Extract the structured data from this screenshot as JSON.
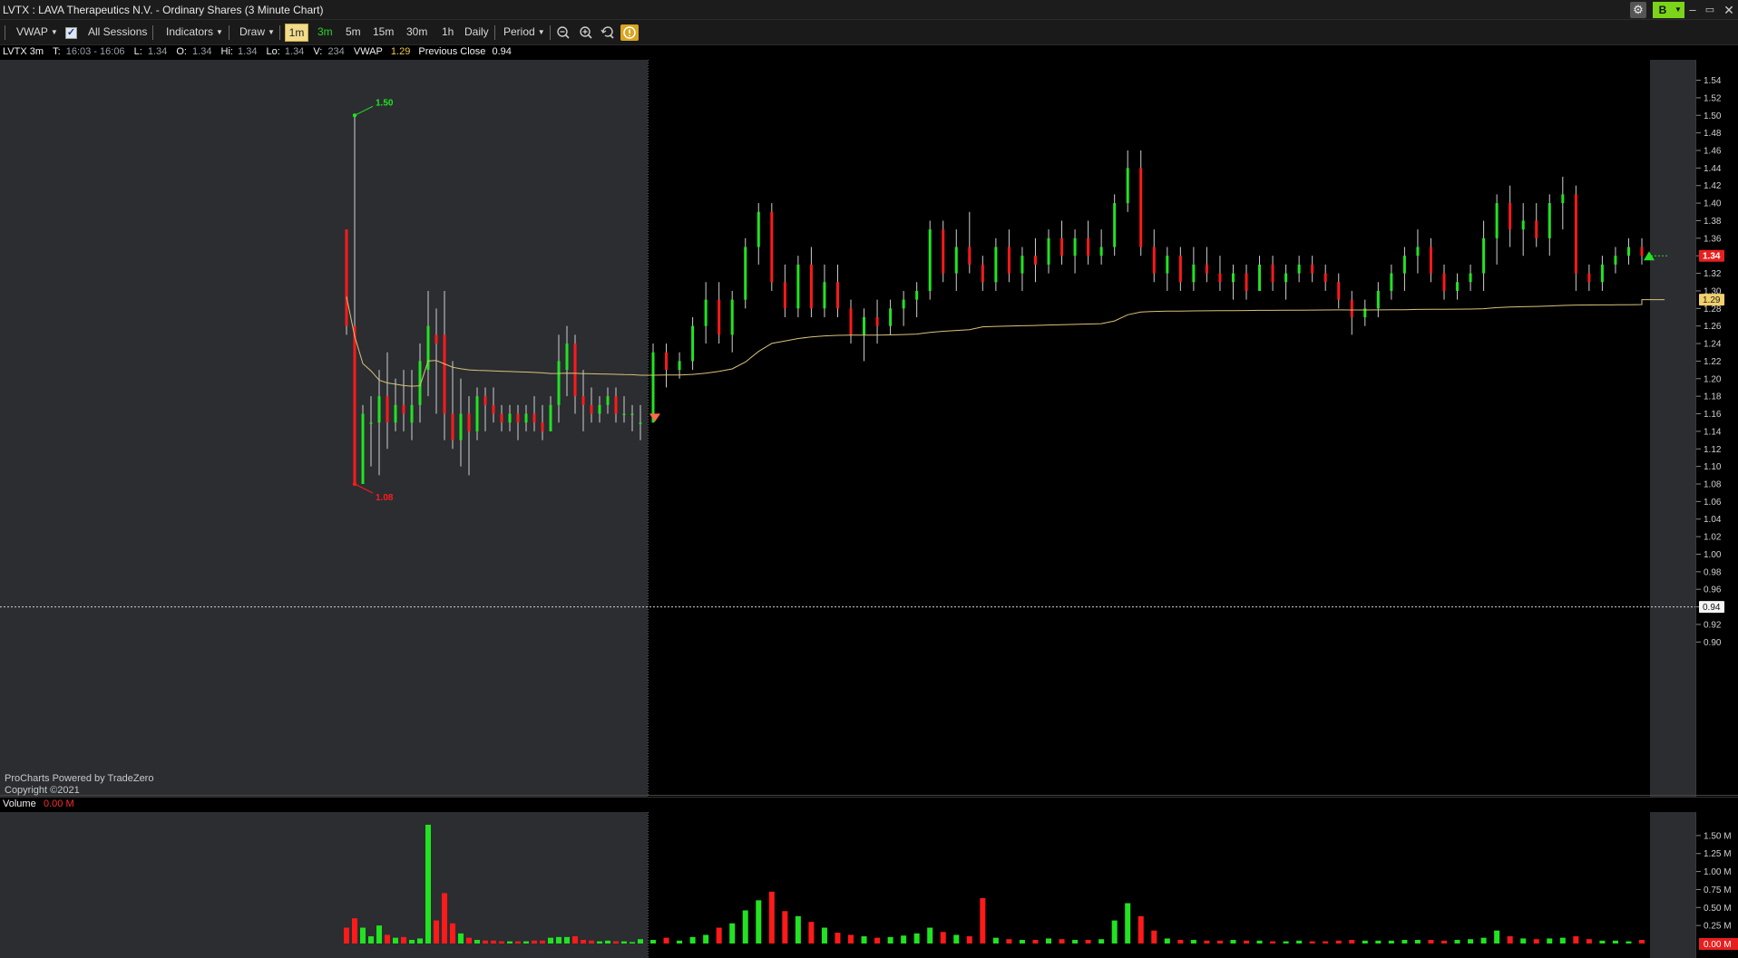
{
  "window": {
    "title": "LVTX : LAVA Therapeutics N.V. - Ordinary Shares (3 Minute Chart)",
    "controls": {
      "gear": "gear-icon",
      "account_label": "B",
      "minimize": "–",
      "maximize": "▭",
      "close": "✕"
    }
  },
  "toolbar": {
    "study_label": "VWAP",
    "sessions_label": "All Sessions",
    "indicators_label": "Indicators",
    "draw_label": "Draw",
    "timeframes": [
      "1m",
      "3m",
      "5m",
      "15m",
      "30m",
      "1h",
      "Daily"
    ],
    "selected_timeframe": "1m",
    "highlighted_timeframe": "3m",
    "period_label": "Period",
    "icons": [
      "zoom-out-icon",
      "zoom-in-icon",
      "reset-zoom-icon",
      "info-icon"
    ]
  },
  "info": {
    "symbol": "LVTX 3m",
    "t_label": "T:",
    "t_value": "16:03 - 16:06",
    "l_label": "L:",
    "l_value": "1.34",
    "o_label": "O:",
    "o_value": "1.34",
    "hi_label": "Hi:",
    "hi_value": "1.34",
    "lo_label": "Lo:",
    "lo_value": "1.34",
    "v_label": "V:",
    "v_value": "234",
    "vwap_label": "VWAP",
    "vwap_value": "1.29",
    "prev_close_label": "Previous Close",
    "prev_close_value": "0.94"
  },
  "footer": {
    "line1": "ProCharts Powered by TradeZero",
    "line2": "Copyright ©2021"
  },
  "volume_panel": {
    "label": "Volume",
    "current": "0.00 M"
  },
  "colors": {
    "up": "#21e321",
    "down": "#ff1a1a",
    "vwap": "#d9c37a",
    "premarket_bg": "#2b2d31",
    "chart_bg": "#000000"
  },
  "chart_data": {
    "type": "candlestick",
    "price_axis": {
      "ylim": [
        0.89,
        1.555
      ],
      "ticks": [
        "1.54",
        "1.52",
        "1.50",
        "1.48",
        "1.46",
        "1.44",
        "1.42",
        "1.40",
        "1.38",
        "1.36",
        "1.34",
        "1.32",
        "1.30",
        "1.28",
        "1.26",
        "1.24",
        "1.22",
        "1.20",
        "1.18",
        "1.16",
        "1.14",
        "1.12",
        "1.10",
        "1.08",
        "1.06",
        "1.04",
        "1.02",
        "1.00",
        "0.98",
        "0.96",
        "0.94",
        "0.92",
        "0.90"
      ]
    },
    "volume_axis": {
      "ylim": [
        0,
        1.7
      ],
      "unit": "M",
      "ticks": [
        "1.50 M",
        "1.25 M",
        "1.00 M",
        "0.75 M",
        "0.50 M",
        "0.25 M"
      ]
    },
    "last_price": "1.34",
    "vwap_last": "1.29",
    "previous_close": "0.94",
    "annotations": {
      "high_label": "1.50",
      "low_label": "1.08"
    },
    "candles": [
      [
        1.37,
        1.37,
        1.25,
        1.26,
        0.22
      ],
      [
        1.26,
        1.5,
        1.08,
        1.08,
        0.35
      ],
      [
        1.08,
        1.17,
        1.08,
        1.16,
        0.22
      ],
      [
        1.15,
        1.18,
        1.1,
        1.15,
        0.1
      ],
      [
        1.15,
        1.21,
        1.09,
        1.18,
        0.25
      ],
      [
        1.18,
        1.23,
        1.12,
        1.15,
        0.12
      ],
      [
        1.15,
        1.2,
        1.14,
        1.17,
        0.08
      ],
      [
        1.17,
        1.21,
        1.14,
        1.16,
        0.09
      ],
      [
        1.15,
        1.21,
        1.13,
        1.17,
        0.05
      ],
      [
        1.17,
        1.24,
        1.15,
        1.22,
        0.07
      ],
      [
        1.21,
        1.3,
        1.18,
        1.26,
        1.65
      ],
      [
        1.25,
        1.28,
        1.16,
        1.24,
        0.32
      ],
      [
        1.25,
        1.3,
        1.13,
        1.16,
        0.7
      ],
      [
        1.16,
        1.22,
        1.12,
        1.13,
        0.28
      ],
      [
        1.13,
        1.2,
        1.1,
        1.16,
        0.14
      ],
      [
        1.16,
        1.18,
        1.09,
        1.14,
        0.08
      ],
      [
        1.14,
        1.19,
        1.13,
        1.18,
        0.05
      ],
      [
        1.18,
        1.19,
        1.14,
        1.17,
        0.04
      ],
      [
        1.17,
        1.19,
        1.15,
        1.16,
        0.04
      ],
      [
        1.16,
        1.17,
        1.14,
        1.15,
        0.03
      ],
      [
        1.15,
        1.17,
        1.14,
        1.16,
        0.03
      ],
      [
        1.16,
        1.17,
        1.13,
        1.15,
        0.03
      ],
      [
        1.15,
        1.17,
        1.14,
        1.16,
        0.03
      ],
      [
        1.16,
        1.18,
        1.14,
        1.15,
        0.04
      ],
      [
        1.15,
        1.17,
        1.13,
        1.14,
        0.04
      ],
      [
        1.14,
        1.18,
        1.14,
        1.17,
        0.08
      ],
      [
        1.17,
        1.25,
        1.15,
        1.22,
        0.09
      ],
      [
        1.21,
        1.26,
        1.18,
        1.24,
        0.09
      ],
      [
        1.24,
        1.25,
        1.16,
        1.18,
        0.1
      ],
      [
        1.18,
        1.21,
        1.14,
        1.17,
        0.05
      ],
      [
        1.17,
        1.19,
        1.15,
        1.16,
        0.04
      ],
      [
        1.16,
        1.18,
        1.15,
        1.17,
        0.03
      ],
      [
        1.17,
        1.19,
        1.16,
        1.18,
        0.04
      ],
      [
        1.18,
        1.19,
        1.15,
        1.16,
        0.03
      ],
      [
        1.16,
        1.18,
        1.15,
        1.16,
        0.03
      ],
      [
        1.16,
        1.17,
        1.14,
        1.16,
        0.02
      ],
      [
        1.15,
        1.17,
        1.13,
        1.15,
        0.06
      ],
      [
        1.15,
        1.24,
        1.15,
        1.23,
        0.05
      ],
      [
        1.23,
        1.24,
        1.19,
        1.21,
        0.08
      ],
      [
        1.21,
        1.23,
        1.2,
        1.22,
        0.04
      ],
      [
        1.22,
        1.27,
        1.21,
        1.26,
        0.09
      ],
      [
        1.26,
        1.31,
        1.24,
        1.29,
        0.12
      ],
      [
        1.29,
        1.31,
        1.24,
        1.25,
        0.22
      ],
      [
        1.25,
        1.3,
        1.23,
        1.29,
        0.28
      ],
      [
        1.29,
        1.36,
        1.28,
        1.35,
        0.46
      ],
      [
        1.35,
        1.4,
        1.33,
        1.39,
        0.6
      ],
      [
        1.39,
        1.4,
        1.3,
        1.31,
        0.72
      ],
      [
        1.31,
        1.33,
        1.27,
        1.28,
        0.45
      ],
      [
        1.28,
        1.34,
        1.27,
        1.33,
        0.38
      ],
      [
        1.33,
        1.35,
        1.27,
        1.28,
        0.3
      ],
      [
        1.28,
        1.33,
        1.27,
        1.31,
        0.22
      ],
      [
        1.31,
        1.33,
        1.27,
        1.28,
        0.15
      ],
      [
        1.28,
        1.29,
        1.24,
        1.25,
        0.12
      ],
      [
        1.25,
        1.28,
        1.22,
        1.27,
        0.1
      ],
      [
        1.27,
        1.29,
        1.24,
        1.26,
        0.08
      ],
      [
        1.26,
        1.29,
        1.25,
        1.28,
        0.09
      ],
      [
        1.28,
        1.3,
        1.26,
        1.29,
        0.11
      ],
      [
        1.29,
        1.31,
        1.27,
        1.3,
        0.14
      ],
      [
        1.3,
        1.38,
        1.29,
        1.37,
        0.22
      ],
      [
        1.37,
        1.38,
        1.31,
        1.32,
        0.16
      ],
      [
        1.32,
        1.37,
        1.3,
        1.35,
        0.12
      ],
      [
        1.35,
        1.39,
        1.32,
        1.33,
        0.1
      ],
      [
        1.33,
        1.34,
        1.3,
        1.31,
        0.63
      ],
      [
        1.31,
        1.36,
        1.3,
        1.35,
        0.08
      ],
      [
        1.35,
        1.37,
        1.31,
        1.32,
        0.06
      ],
      [
        1.32,
        1.35,
        1.3,
        1.34,
        0.05
      ],
      [
        1.34,
        1.36,
        1.31,
        1.33,
        0.05
      ],
      [
        1.33,
        1.37,
        1.32,
        1.36,
        0.07
      ],
      [
        1.36,
        1.38,
        1.33,
        1.34,
        0.06
      ],
      [
        1.34,
        1.37,
        1.32,
        1.36,
        0.05
      ],
      [
        1.36,
        1.38,
        1.33,
        1.34,
        0.05
      ],
      [
        1.34,
        1.37,
        1.33,
        1.35,
        0.06
      ],
      [
        1.35,
        1.41,
        1.34,
        1.4,
        0.32
      ],
      [
        1.4,
        1.46,
        1.39,
        1.44,
        0.56
      ],
      [
        1.44,
        1.46,
        1.34,
        1.35,
        0.38
      ],
      [
        1.35,
        1.37,
        1.31,
        1.32,
        0.18
      ],
      [
        1.32,
        1.35,
        1.3,
        1.34,
        0.07
      ],
      [
        1.34,
        1.35,
        1.3,
        1.31,
        0.05
      ],
      [
        1.31,
        1.35,
        1.3,
        1.33,
        0.05
      ],
      [
        1.33,
        1.35,
        1.31,
        1.32,
        0.04
      ],
      [
        1.32,
        1.34,
        1.3,
        1.31,
        0.04
      ],
      [
        1.31,
        1.33,
        1.29,
        1.32,
        0.05
      ],
      [
        1.32,
        1.33,
        1.29,
        1.3,
        0.04
      ],
      [
        1.3,
        1.34,
        1.3,
        1.33,
        0.04
      ],
      [
        1.33,
        1.34,
        1.3,
        1.31,
        0.03
      ],
      [
        1.31,
        1.33,
        1.29,
        1.32,
        0.03
      ],
      [
        1.32,
        1.34,
        1.31,
        1.33,
        0.04
      ],
      [
        1.33,
        1.34,
        1.31,
        1.32,
        0.03
      ],
      [
        1.32,
        1.33,
        1.3,
        1.31,
        0.03
      ],
      [
        1.31,
        1.32,
        1.28,
        1.29,
        0.04
      ],
      [
        1.29,
        1.3,
        1.25,
        1.27,
        0.05
      ],
      [
        1.27,
        1.29,
        1.26,
        1.28,
        0.04
      ],
      [
        1.28,
        1.31,
        1.27,
        1.3,
        0.04
      ],
      [
        1.3,
        1.33,
        1.29,
        1.32,
        0.04
      ],
      [
        1.32,
        1.35,
        1.3,
        1.34,
        0.05
      ],
      [
        1.34,
        1.37,
        1.32,
        1.35,
        0.05
      ],
      [
        1.35,
        1.36,
        1.31,
        1.32,
        0.05
      ],
      [
        1.32,
        1.33,
        1.29,
        1.3,
        0.04
      ],
      [
        1.3,
        1.32,
        1.29,
        1.31,
        0.05
      ],
      [
        1.31,
        1.33,
        1.3,
        1.32,
        0.06
      ],
      [
        1.32,
        1.38,
        1.3,
        1.36,
        0.08
      ],
      [
        1.36,
        1.41,
        1.33,
        1.4,
        0.18
      ],
      [
        1.4,
        1.42,
        1.35,
        1.37,
        0.1
      ],
      [
        1.37,
        1.4,
        1.34,
        1.38,
        0.07
      ],
      [
        1.38,
        1.4,
        1.35,
        1.36,
        0.06
      ],
      [
        1.36,
        1.41,
        1.34,
        1.4,
        0.07
      ],
      [
        1.4,
        1.43,
        1.37,
        1.41,
        0.08
      ],
      [
        1.41,
        1.42,
        1.3,
        1.32,
        0.1
      ],
      [
        1.32,
        1.33,
        1.3,
        1.31,
        0.06
      ],
      [
        1.31,
        1.34,
        1.3,
        1.33,
        0.04
      ],
      [
        1.33,
        1.35,
        1.32,
        1.34,
        0.04
      ],
      [
        1.34,
        1.36,
        1.33,
        1.35,
        0.03
      ],
      [
        1.35,
        1.36,
        1.33,
        1.34,
        0.05
      ]
    ]
  }
}
